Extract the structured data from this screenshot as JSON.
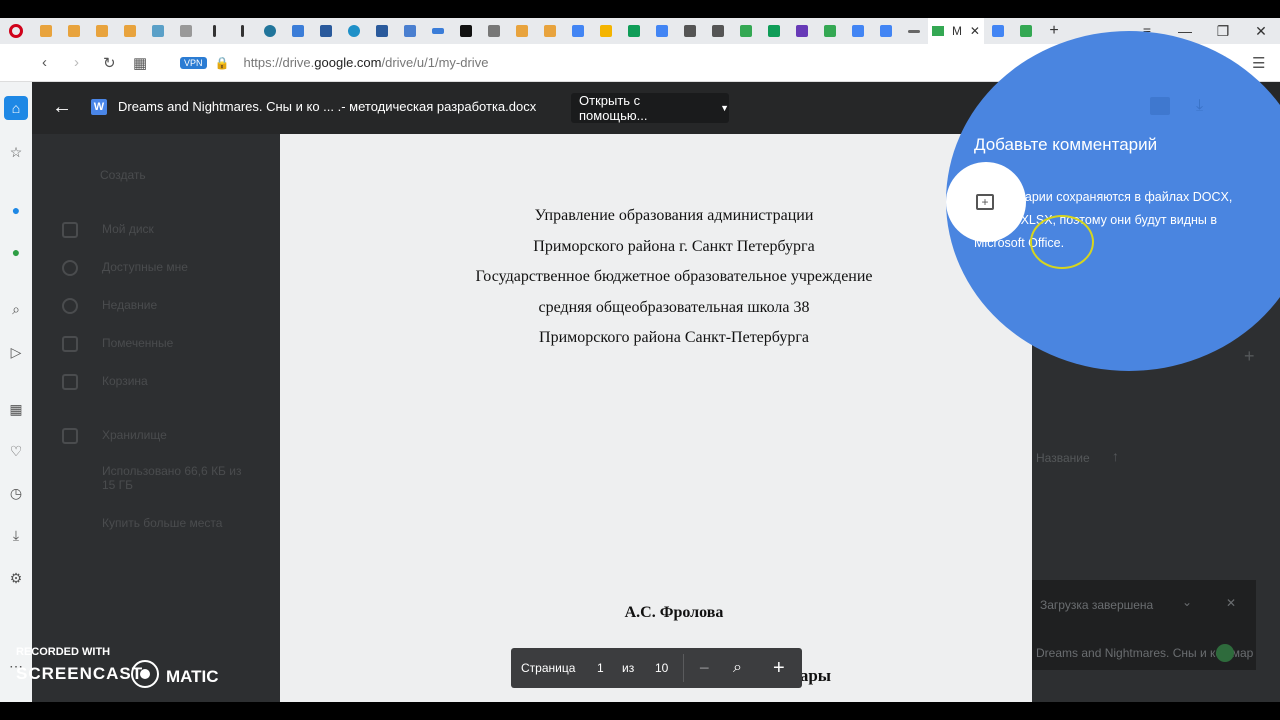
{
  "browser": {
    "url_prefix": "https://drive.",
    "url_domain": "google.com",
    "url_path": "/drive/u/1/my-drive",
    "vpn_label": "VPN",
    "active_tab_label": "M"
  },
  "drive": {
    "create_label": "Создать",
    "nav_items": [
      "Мой диск",
      "Доступные мне",
      "Недавние",
      "Помеченные",
      "Корзина",
      "Хранилище"
    ],
    "storage_text": "Использовано 66,6 КБ из 15 ГБ",
    "buy_more": "Купить больше места",
    "sort_label": "Название",
    "upload_status": "Загрузка завершена",
    "upload_file": "Dreams and Nightmares. Сны и кошмар"
  },
  "viewer": {
    "title": "Dreams and Nightmares. Сны и ко ... .- методическая разработка.docx",
    "open_with": "Открыть с помощью...",
    "file_icon_letter": "W"
  },
  "document": {
    "header_lines": [
      "Управление образования администрации",
      "Приморского района г. Санкт Петербурга",
      "Государственное бюджетное образовательное учреждение",
      "средняя общеобразовательная школа 38",
      "Приморского района Санкт-Петербурга"
    ],
    "author": "А.С. Фролова",
    "doc_title": "Dreams and Nightmares. Сны и кошмары"
  },
  "pager": {
    "page_label": "Страница",
    "current": "1",
    "of_label": "из",
    "total": "10"
  },
  "comment_tip": {
    "title": "Добавьте комментарий",
    "text": "Комментарии сохраняются в файлах DOCX, PPTX и XLSX, поэтому они будут видны в Microsoft Office."
  },
  "watermark": {
    "line1": "RECORDED WITH",
    "brand_left": "SCREENCAST",
    "brand_right": "MATIC"
  }
}
